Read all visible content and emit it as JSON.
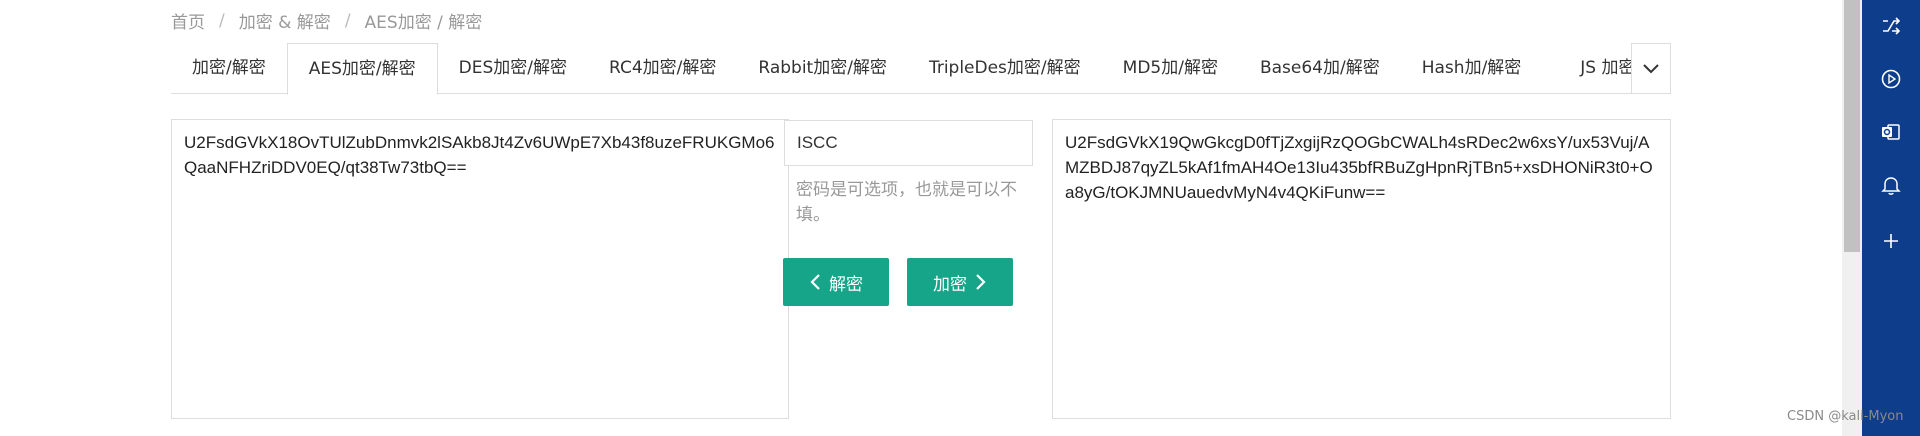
{
  "breadcrumb": {
    "home": "首页",
    "sep": "/",
    "section": "加密 & 解密",
    "current": "AES加密 / 解密"
  },
  "tabs": [
    {
      "label": "加密/解密",
      "active": false
    },
    {
      "label": "AES加密/解密",
      "active": true
    },
    {
      "label": "DES加密/解密",
      "active": false
    },
    {
      "label": "RC4加密/解密",
      "active": false
    },
    {
      "label": "Rabbit加密/解密",
      "active": false
    },
    {
      "label": "TripleDes加密/解密",
      "active": false
    },
    {
      "label": "MD5加/解密",
      "active": false
    },
    {
      "label": "Base64加/解密",
      "active": false
    },
    {
      "label": "Hash加/解密",
      "active": false
    },
    {
      "label": "JS 加密",
      "active": false
    }
  ],
  "left_text": "U2FsdGVkX18OvTUlZubDnmvk2lSAkb8Jt4Zv6UWpE7Xb43f8uzeFRUKGMo6QaaNFHZriDDV0EQ/qt38Tw73tbQ==",
  "right_text": "U2FsdGVkX19QwGkcgD0fTjZxgijRzQOGbCWALh4sRDec2w6xsY/ux53Vuj/AMZBDJ87qyZL5kAf1fmAH4Oe13Iu435bfRBuZgHpnRjTBn5+xsDHONiR3t0+Oa8yG/tOKJMNUauedvMyN4v4QKiFunw==",
  "key_input": {
    "value": "ISCC"
  },
  "hint": "密码是可选项，也就是可以不填。",
  "buttons": {
    "decrypt": "解密",
    "encrypt": "加密"
  },
  "watermark": "CSDN @kali-Myon",
  "colors": {
    "accent": "#17a589",
    "sidebar": "#0e3d8c"
  },
  "sidebar_icons": [
    "shuffle-icon",
    "play-icon",
    "outlook-icon",
    "bell-icon",
    "plus-icon"
  ]
}
